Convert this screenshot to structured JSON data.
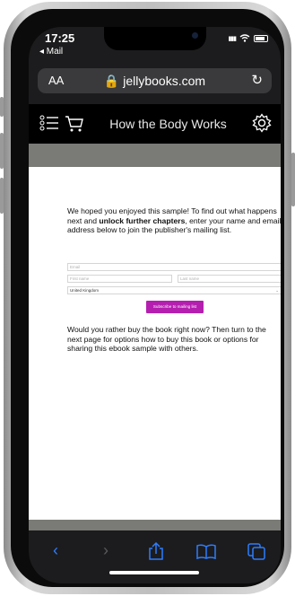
{
  "status_bar": {
    "time": "17:25",
    "back_app": "◂ Mail",
    "signal": "▮▮▮",
    "wifi": "wifi"
  },
  "browser": {
    "text_size": "AA",
    "url": "🔒 jellybooks.com",
    "reload": "↻"
  },
  "reader": {
    "title": "How the Body Works"
  },
  "content": {
    "intro_before": "We hoped you enjoyed this sample! To find out what happens next and ",
    "intro_bold": "unlock further chapters",
    "intro_after": ", enter your name and email address below to join the publisher's mailing list.",
    "email_placeholder": "Email",
    "first_name_placeholder": "First name",
    "last_name_placeholder": "Last name",
    "country_value": "United Kingdom",
    "subscribe_label": "Subscribe to mailing list",
    "outro": "Would you rather buy the book right now? Then turn to the next page for options how to buy this book or options for sharing this ebook sample with others."
  },
  "toolbar": {
    "back": "‹",
    "forward": "›"
  },
  "colors": {
    "accent_blue": "#2d7dff",
    "subscribe_purple": "#b51fb0"
  }
}
